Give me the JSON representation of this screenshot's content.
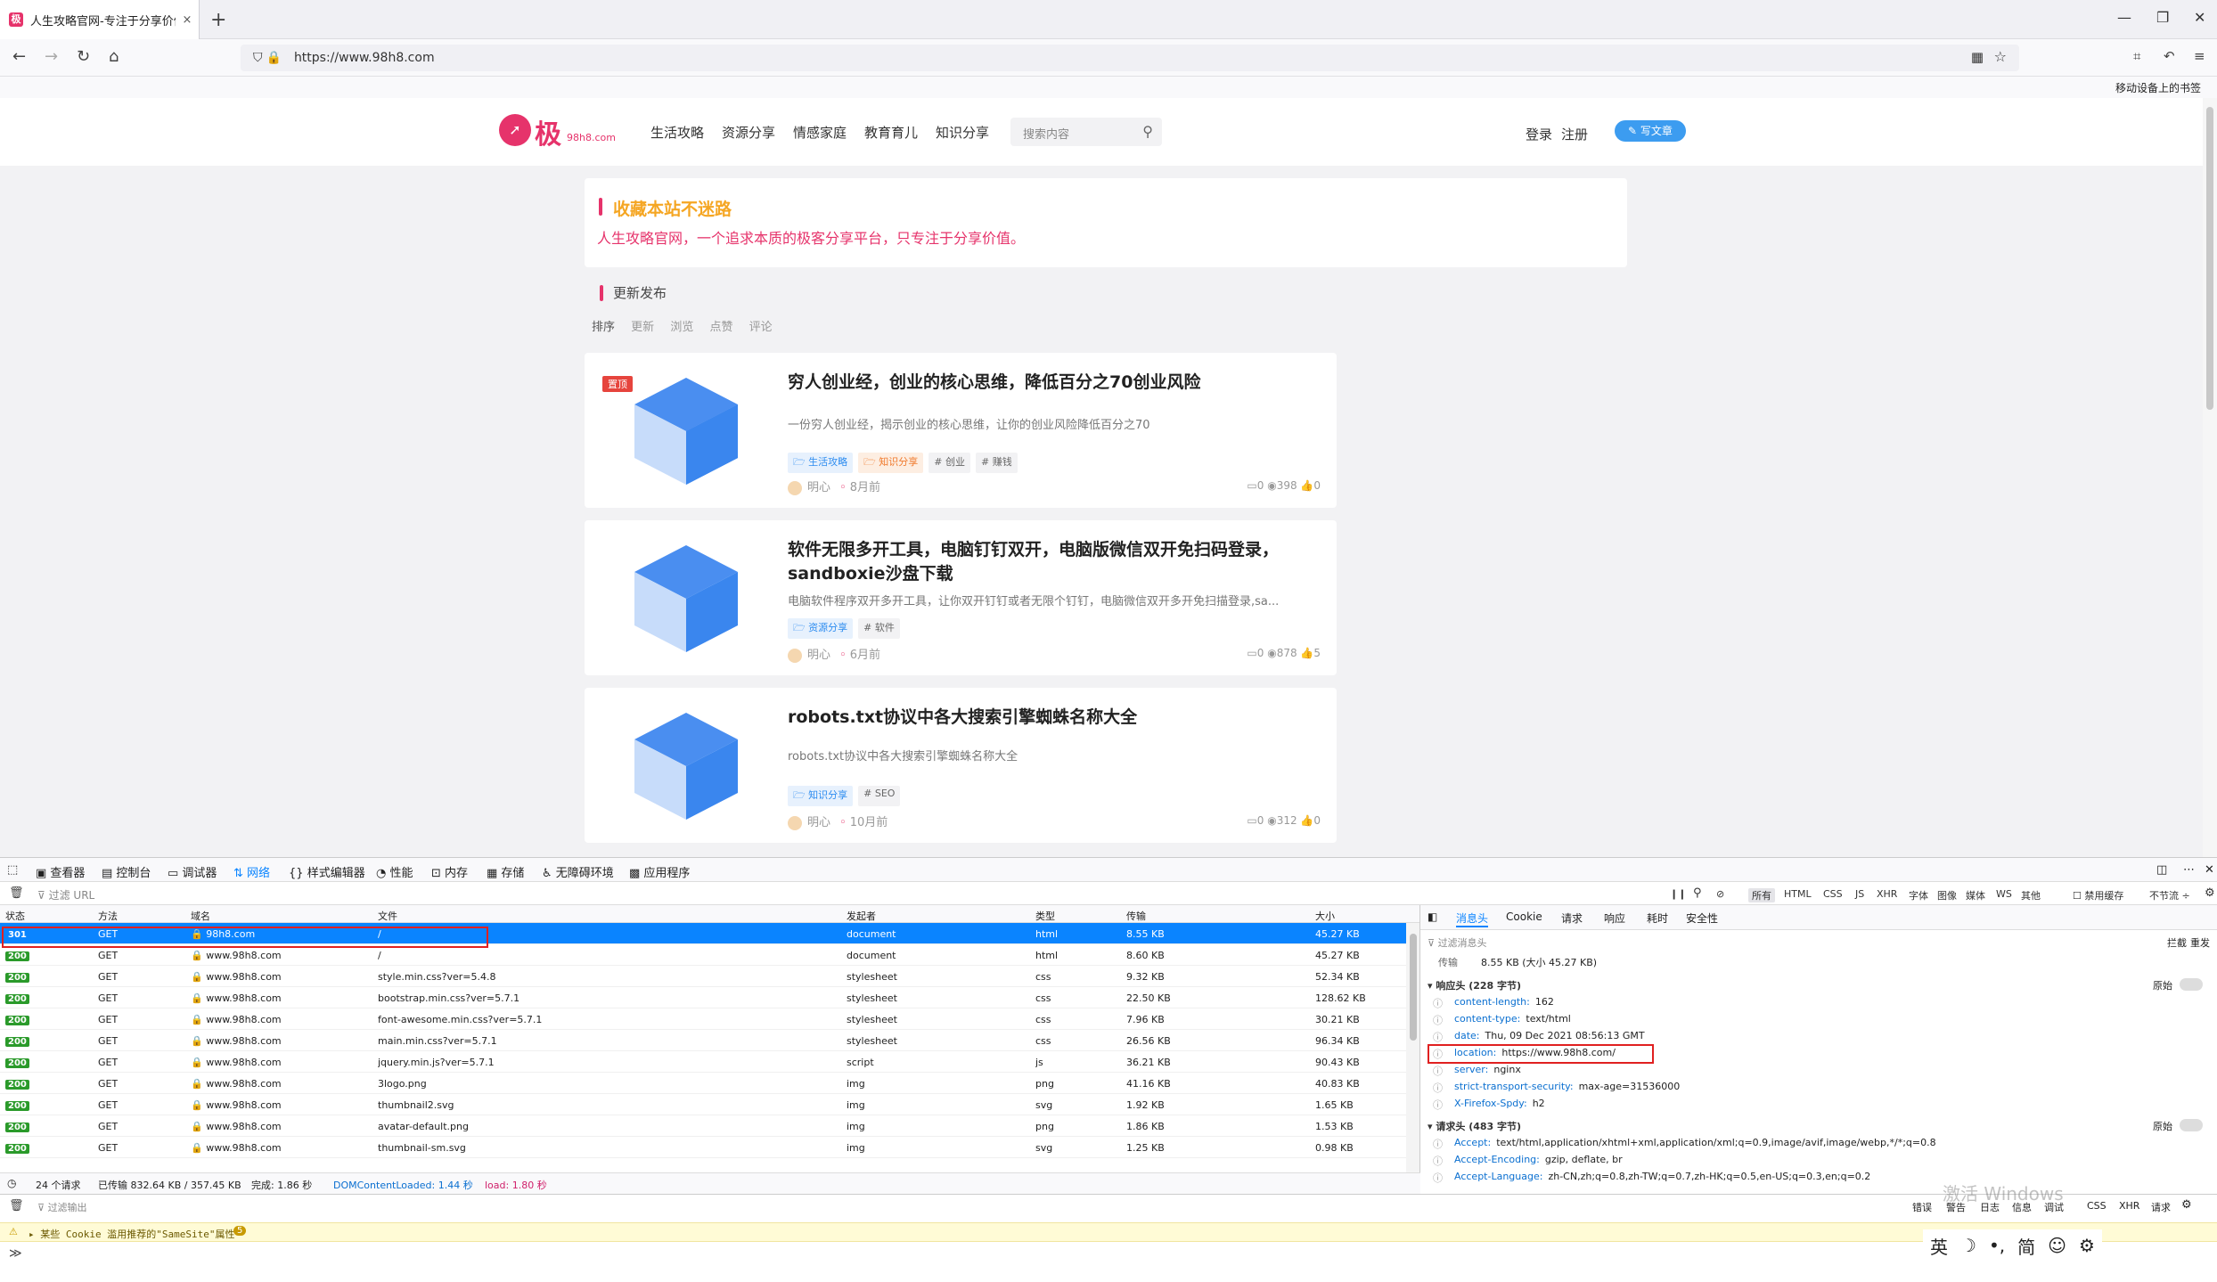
{
  "browser": {
    "tab_title": "人生攻略官网-专注于分享价值",
    "tab_icon_text": "极",
    "tab_close": "×",
    "new_tab": "+",
    "url": "https://www.98h8.com",
    "mobile_bookmarks": "移动设备上的书签"
  },
  "site": {
    "logo_text": "极",
    "logo_domain": "98h8.com",
    "menu": [
      "生活攻略",
      "资源分享",
      "情感家庭",
      "教育育儿",
      "知识分享"
    ],
    "search_placeholder": "搜索内容",
    "login": "登录",
    "register": "注册",
    "write": "写文章",
    "notice_title": "收藏本站不迷路",
    "notice_desc": "人生攻略官网，一个追求本质的极客分享平台，只专注于分享价值。",
    "latest_label": "更新发布",
    "sort_label": "排序",
    "sort_options": [
      "更新",
      "浏览",
      "点赞",
      "评论"
    ],
    "top_badge": "置顶",
    "articles": [
      {
        "title": "穷人创业经，创业的核心思维，降低百分之70创业风险",
        "desc": "一份穷人创业经，揭示创业的核心思维，让你的创业风险降低百分之70",
        "tags": [
          "生活攻略",
          "知识分享",
          "# 创业",
          "# 赚钱"
        ],
        "author": "明心",
        "time": "8月前",
        "comments": "0",
        "views": "398",
        "likes": "0"
      },
      {
        "title": "软件无限多开工具，电脑钉钉双开，电脑版微信双开免扫码登录，sandboxie沙盘下载",
        "desc": "电脑软件程序双开多开工具，让你双开钉钉或者无限个钉钉，电脑微信双开多开免扫描登录,sa...",
        "tags": [
          "资源分享",
          "# 软件"
        ],
        "author": "明心",
        "time": "6月前",
        "comments": "0",
        "views": "878",
        "likes": "5"
      },
      {
        "title": "robots.txt协议中各大搜索引擎蜘蛛名称大全",
        "desc": "robots.txt协议中各大搜索引擎蜘蛛名称大全",
        "tags": [
          "知识分享",
          "# SEO"
        ],
        "author": "明心",
        "time": "10月前",
        "comments": "0",
        "views": "312",
        "likes": "0"
      }
    ]
  },
  "devtools": {
    "tools": [
      "查看器",
      "控制台",
      "调试器",
      "网络",
      "样式编辑器",
      "性能",
      "内存",
      "存储",
      "无障碍环境",
      "应用程序"
    ],
    "filter_placeholder": "过滤 URL",
    "type_filters": [
      "所有",
      "HTML",
      "CSS",
      "JS",
      "XHR",
      "字体",
      "图像",
      "媒体",
      "WS",
      "其他"
    ],
    "disable_cache": "禁用缓存",
    "throttle": "不节流 ÷",
    "columns": [
      "状态",
      "方法",
      "域名",
      "文件",
      "发起者",
      "类型",
      "传输",
      "大小"
    ],
    "requests": [
      {
        "status": "301",
        "method": "GET",
        "domain": "98h8.com",
        "file": "/",
        "initiator": "document",
        "type": "html",
        "transfer": "8.55 KB",
        "size": "45.27 KB"
      },
      {
        "status": "200",
        "method": "GET",
        "domain": "www.98h8.com",
        "file": "/",
        "initiator": "document",
        "type": "html",
        "transfer": "8.60 KB",
        "size": "45.27 KB"
      },
      {
        "status": "200",
        "method": "GET",
        "domain": "www.98h8.com",
        "file": "style.min.css?ver=5.4.8",
        "initiator": "stylesheet",
        "type": "css",
        "transfer": "9.32 KB",
        "size": "52.34 KB"
      },
      {
        "status": "200",
        "method": "GET",
        "domain": "www.98h8.com",
        "file": "bootstrap.min.css?ver=5.7.1",
        "initiator": "stylesheet",
        "type": "css",
        "transfer": "22.50 KB",
        "size": "128.62 KB"
      },
      {
        "status": "200",
        "method": "GET",
        "domain": "www.98h8.com",
        "file": "font-awesome.min.css?ver=5.7.1",
        "initiator": "stylesheet",
        "type": "css",
        "transfer": "7.96 KB",
        "size": "30.21 KB"
      },
      {
        "status": "200",
        "method": "GET",
        "domain": "www.98h8.com",
        "file": "main.min.css?ver=5.7.1",
        "initiator": "stylesheet",
        "type": "css",
        "transfer": "26.56 KB",
        "size": "96.34 KB"
      },
      {
        "status": "200",
        "method": "GET",
        "domain": "www.98h8.com",
        "file": "jquery.min.js?ver=5.7.1",
        "initiator": "script",
        "type": "js",
        "transfer": "36.21 KB",
        "size": "90.43 KB"
      },
      {
        "status": "200",
        "method": "GET",
        "domain": "www.98h8.com",
        "file": "3logo.png",
        "initiator": "img",
        "type": "png",
        "transfer": "41.16 KB",
        "size": "40.83 KB"
      },
      {
        "status": "200",
        "method": "GET",
        "domain": "www.98h8.com",
        "file": "thumbnail2.svg",
        "initiator": "img",
        "type": "svg",
        "transfer": "1.92 KB",
        "size": "1.65 KB"
      },
      {
        "status": "200",
        "method": "GET",
        "domain": "www.98h8.com",
        "file": "avatar-default.png",
        "initiator": "img",
        "type": "png",
        "transfer": "1.86 KB",
        "size": "1.53 KB"
      },
      {
        "status": "200",
        "method": "GET",
        "domain": "www.98h8.com",
        "file": "thumbnail-sm.svg",
        "initiator": "img",
        "type": "svg",
        "transfer": "1.25 KB",
        "size": "0.98 KB"
      }
    ],
    "status": {
      "count": "24 个请求",
      "transferred": "已传输 832.64 KB / 357.45 KB",
      "finish": "完成: 1.86 秒",
      "dcl": "DOMContentLoaded: 1.44 秒",
      "load": "load: 1.80 秒"
    },
    "detail_tabs": [
      "消息头",
      "Cookie",
      "请求",
      "响应",
      "耗时",
      "安全性"
    ],
    "filter_headers": "过滤消息头",
    "block": "拦截",
    "resend": "重发",
    "transfer_label": "传输",
    "transfer_value": "8.55 KB (大小 45.27 KB)",
    "resp_section": "响应头 (228 字节)",
    "raw": "原始",
    "resp_headers": [
      {
        "k": "content-length:",
        "v": "162"
      },
      {
        "k": "content-type:",
        "v": "text/html"
      },
      {
        "k": "date:",
        "v": "Thu, 09 Dec 2021 08:56:13 GMT"
      },
      {
        "k": "location:",
        "v": "https://www.98h8.com/"
      },
      {
        "k": "server:",
        "v": "nginx"
      },
      {
        "k": "strict-transport-security:",
        "v": "max-age=31536000"
      },
      {
        "k": "X-Firefox-Spdy:",
        "v": "h2"
      }
    ],
    "req_section": "请求头 (483 字节)",
    "req_headers": [
      {
        "k": "Accept:",
        "v": "text/html,application/xhtml+xml,application/xml;q=0.9,image/avif,image/webp,*/*;q=0.8"
      },
      {
        "k": "Accept-Encoding:",
        "v": "gzip, deflate, br"
      },
      {
        "k": "Accept-Language:",
        "v": "zh-CN,zh;q=0.8,zh-TW;q=0.7,zh-HK;q=0.5,en-US;q=0.3,en;q=0.2"
      }
    ],
    "console_filter": "过滤输出",
    "console_levels": [
      "错误",
      "警告",
      "日志",
      "信息",
      "调试",
      "CSS",
      "XHR",
      "请求"
    ],
    "warning": "▸ 某些 Cookie 滥用推荐的\"SameSite\"属性",
    "warning_count": "5",
    "prompt": "≫"
  },
  "os": {
    "ime": [
      "英",
      "☽",
      "•,",
      "简",
      "☺",
      "⚙"
    ],
    "watermark": "激活 Windows"
  },
  "colors": {
    "brand": "#e6336b",
    "accent": "#0a84ff",
    "ok": "#2a9a2a",
    "highlight_box": "#e02020"
  }
}
